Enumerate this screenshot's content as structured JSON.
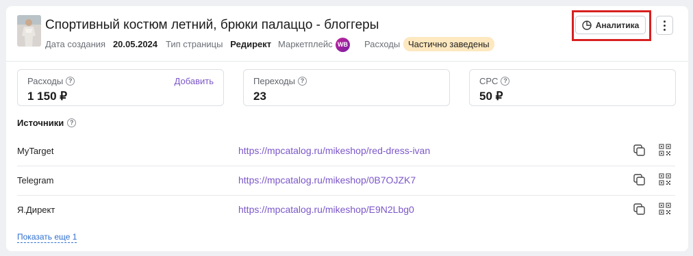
{
  "header": {
    "title": "Спортивный костюм летний, брюки палаццо - блоггеры",
    "created_label": "Дата создания",
    "created_value": "20.05.2024",
    "page_type_label": "Тип страницы",
    "page_type_value": "Редирект",
    "marketplace_label": "Маркетплейс",
    "marketplace_badge": "WB",
    "expenses_label": "Расходы",
    "expenses_status": "Частично заведены",
    "analytics_button": "Аналитика",
    "more_icon": "vertical-dots-icon",
    "analytics_icon": "pie-chart-icon"
  },
  "stats": [
    {
      "label": "Расходы",
      "value": "1 150 ₽",
      "action": "Добавить"
    },
    {
      "label": "Переходы",
      "value": "23"
    },
    {
      "label": "CPC",
      "value": "50 ₽"
    }
  ],
  "sources": {
    "title": "Источники",
    "rows": [
      {
        "name": "MyTarget",
        "url": "https://mpcatalog.ru/mikeshop/red-dress-ivan"
      },
      {
        "name": "Telegram",
        "url": "https://mpcatalog.ru/mikeshop/0B7OJZK7"
      },
      {
        "name": "Я.Директ",
        "url": "https://mpcatalog.ru/mikeshop/E9N2Lbg0"
      }
    ],
    "show_more": "Показать еще 1"
  },
  "colors": {
    "accent": "#7b56c9",
    "link": "#2f6fd0",
    "highlight": "#d7201f",
    "status_badge_bg": "#fde8bf",
    "wb_badge": "#a9249f"
  }
}
